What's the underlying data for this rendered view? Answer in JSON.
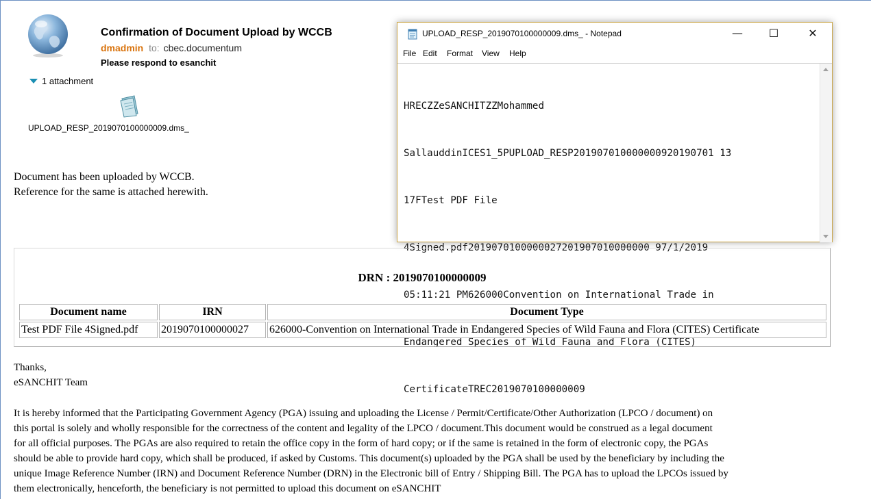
{
  "email": {
    "subject": "Confirmation of Document Upload by WCCB",
    "sender": "dmadmin",
    "to_label": "to:",
    "recipient": "cbec.documentum",
    "respond_note": "Please respond to esanchit",
    "attachments_toggle": "1 attachment",
    "attachment_name": "UPLOAD_RESP_2019070100000009.dms_",
    "body_line1": "Document has been uploaded by WCCB.",
    "body_line2": "Reference for the same is attached herewith."
  },
  "notepad": {
    "title": "UPLOAD_RESP_2019070100000009.dms_ - Notepad",
    "menu": [
      "File",
      "Edit",
      "Format",
      "View",
      "Help"
    ],
    "lines": [
      "HRECZZeSANCHITZZMohammed",
      "SallauddinICES1_5PUPLOAD_RESP201907010000000920190701 13",
      "17FTest PDF File",
      "4Signed.pdf2019070100000027201907010000000 97/1/2019",
      "05:11:21 PM626000Convention on International Trade in",
      "Endangered Species of Wild Fauna and Flora (CITES)",
      "CertificateTREC2019070100000009"
    ],
    "icons": [
      "notepad-app-icon",
      "minimize-icon",
      "maximize-icon",
      "close-icon"
    ]
  },
  "drn": {
    "title": "DRN : 2019070100000009",
    "headers": [
      "Document name",
      "IRN",
      "Document Type"
    ],
    "rows": [
      [
        "Test PDF File 4Signed.pdf",
        "2019070100000027",
        "626000-Convention on International Trade in Endangered Species of Wild Fauna and Flora (CITES) Certificate"
      ]
    ]
  },
  "signature": {
    "thanks": "Thanks,",
    "team": "eSANCHIT Team"
  },
  "disclaimer": {
    "lines": [
      "It is hereby informed that the Participating Government Agency (PGA) issuing and uploading the License / Permit/Certificate/Other Authorization (LPCO / document) on",
      "this portal is solely and wholly responsible for the correctness of the content and legality of the LPCO / document.This document would be construed as a legal document",
      "for all official purposes. The PGAs are also required to retain the office copy in the form of hard copy; or if the same is retained in the form of electronic copy, the PGAs",
      "should be able to provide hard copy, which shall be produced, if asked by Customs. This document(s) uploaded by the PGA shall be used by the beneficiary by including the",
      "unique Image Reference Number (IRN) and Document Reference Number (DRN) in the Electronic bill of Entry / Shipping Bill. The PGA has to upload the LPCOs issued by",
      "them electronically, henceforth, the beneficiary is not permitted to upload this document on eSANCHIT"
    ]
  },
  "colors": {
    "sender": "#d9730d",
    "accent_triangle": "#1b8fb3",
    "notepad_border": "#c9a341",
    "frame_border": "#6b8fc2"
  }
}
